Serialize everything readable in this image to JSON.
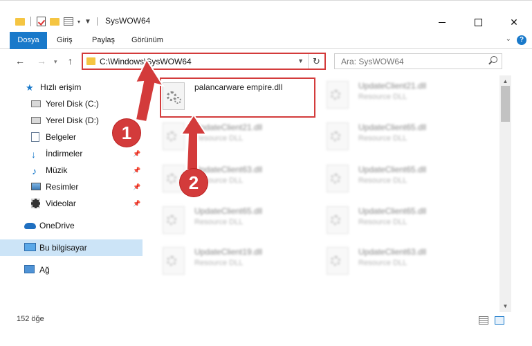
{
  "window": {
    "title": "SysWOW64"
  },
  "ribbon": {
    "tabs": [
      "Dosya",
      "Giriş",
      "Paylaş",
      "Görünüm"
    ],
    "help": "?"
  },
  "address": {
    "path": "C:\\Windows\\SysWOW64"
  },
  "search": {
    "placeholder": "Ara: SysWOW64"
  },
  "sidebar": {
    "items": [
      {
        "label": "Hızlı erişim",
        "icon": "star-icon"
      },
      {
        "label": "Yerel Disk (C:)",
        "icon": "drive-icon"
      },
      {
        "label": "Yerel Disk (D:)",
        "icon": "drive-icon"
      },
      {
        "label": "Belgeler",
        "icon": "documents-icon"
      },
      {
        "label": "İndirmeler",
        "icon": "download-arrow-icon"
      },
      {
        "label": "Müzik",
        "icon": "music-note-icon"
      },
      {
        "label": "Resimler",
        "icon": "pictures-icon"
      },
      {
        "label": "Videolar",
        "icon": "film-icon"
      },
      {
        "label": "OneDrive",
        "icon": "cloud-icon"
      },
      {
        "label": "Bu bilgisayar",
        "icon": "computer-icon"
      },
      {
        "label": "Ağ",
        "icon": "network-icon"
      }
    ]
  },
  "files": [
    {
      "name": "palancarware empire.dll",
      "desc": ""
    },
    {
      "name": "UpdateClient21.dll",
      "desc": "Resource DLL"
    },
    {
      "name": "UpdateClient21.dll",
      "desc": "Resource DLL"
    },
    {
      "name": "UpdateClient65.dll",
      "desc": "Resource DLL"
    },
    {
      "name": "UpdateClient63.dll",
      "desc": "Resource DLL"
    },
    {
      "name": "UpdateClient65.dll",
      "desc": "Resource DLL"
    },
    {
      "name": "UpdateClient65.dll",
      "desc": "Resource DLL"
    },
    {
      "name": "UpdateClient65.dll",
      "desc": "Resource DLL"
    },
    {
      "name": "UpdateClient19.dll",
      "desc": "Resource DLL"
    },
    {
      "name": "UpdateClient63.dll",
      "desc": "Resource DLL"
    }
  ],
  "status": {
    "count": "152 öğe"
  },
  "callouts": {
    "one": "1",
    "two": "2"
  },
  "colors": {
    "accent": "#1979ca",
    "highlight": "#d33b3b",
    "selected": "#cce4f7"
  }
}
